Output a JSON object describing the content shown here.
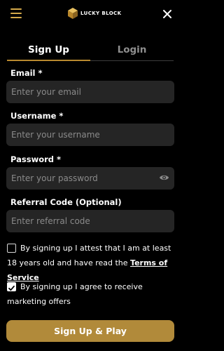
{
  "header": {
    "brand": "LUCKY BLOCK",
    "brand_color": "#d4a94a"
  },
  "tabs": [
    {
      "label": "Sign Up",
      "active": true
    },
    {
      "label": "Login",
      "active": false
    }
  ],
  "form": {
    "email": {
      "label": "Email *",
      "placeholder": "Enter your email",
      "value": ""
    },
    "username": {
      "label": "Username *",
      "placeholder": "Enter your username",
      "value": ""
    },
    "password": {
      "label": "Password *",
      "placeholder": "Enter your password",
      "value": ""
    },
    "referral": {
      "label": "Referral Code (Optional)",
      "placeholder": "Enter referral code",
      "value": ""
    }
  },
  "consent": {
    "age": {
      "text": "By signing up I attest that I am at least 18 years old and have read the ",
      "link": "Terms of Service",
      "checked": false
    },
    "marketing": {
      "text": "By signing up I agree to receive marketing offers",
      "checked": true
    }
  },
  "submit_label": "Sign Up & Play",
  "colors": {
    "accent": "#b18a3a",
    "background": "#000000",
    "field": "#252525"
  },
  "icons": {
    "menu": "hamburger-icon",
    "close": "close-icon",
    "password_toggle": "eye-icon",
    "checkmark": "checkmark-icon"
  }
}
